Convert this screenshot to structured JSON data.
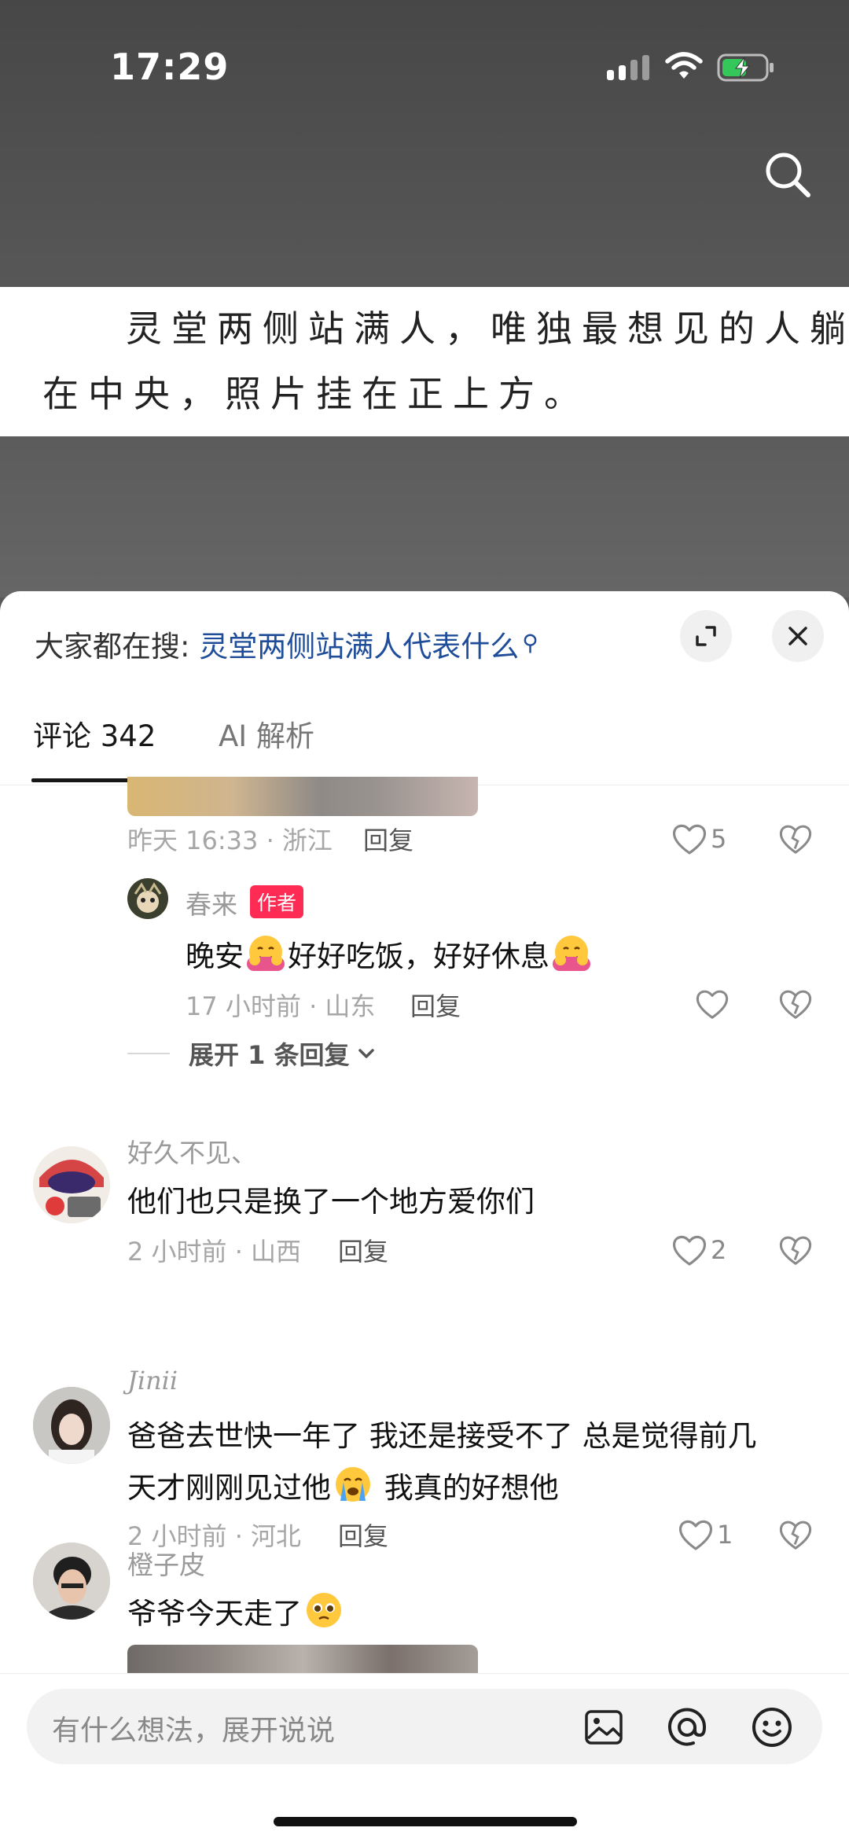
{
  "status_bar": {
    "time": "17:29"
  },
  "video": {
    "caption_line1": "灵堂两侧站满人，唯独最想见的人躺",
    "caption_line2": "在中央，照片挂在正上方。"
  },
  "panel": {
    "hot_search_prefix": "大家都在搜:",
    "hot_search_term": "灵堂两侧站满人代表什么",
    "tabs": [
      {
        "label": "评论 342",
        "active": true
      },
      {
        "label": "AI 解析",
        "active": false
      }
    ]
  },
  "comments": [
    {
      "id": "c0",
      "meta": "昨天 16:33 · 浙江",
      "reply_label": "回复",
      "likes": "5",
      "replies": [
        {
          "name": "春来",
          "badge": "作者",
          "text_part1": "晚安",
          "text_part2": "好好吃饭，好好休息",
          "meta": "17 小时前 · 山东",
          "reply_label": "回复"
        }
      ],
      "expand_label": "展开 1 条回复"
    },
    {
      "id": "c1",
      "name": "好久不见、",
      "text": "他们也只是换了一个地方爱你们",
      "meta": "2 小时前 · 山西",
      "reply_label": "回复",
      "likes": "2"
    },
    {
      "id": "c2",
      "name": "Jinii",
      "text_line1": "爸爸去世快一年了 我还是接受不了 总是觉得前几",
      "text_line2a": "天才刚刚见过他",
      "text_line2b": "我真的好想他",
      "meta": "2 小时前 · 河北",
      "reply_label": "回复",
      "likes": "1"
    },
    {
      "id": "c3",
      "name": "橙子皮",
      "text": "爷爷今天走了"
    }
  ],
  "input": {
    "placeholder": "有什么想法，展开说说"
  },
  "icons": {
    "search": "search-icon",
    "expand": "expand-icon",
    "close": "close-icon",
    "like": "heart-icon",
    "dislike": "broken-heart-icon",
    "image": "image-icon",
    "mention": "at-icon",
    "emoji": "smiley-icon"
  },
  "colors": {
    "accent": "#fe2c55",
    "link": "#1f4d99"
  }
}
